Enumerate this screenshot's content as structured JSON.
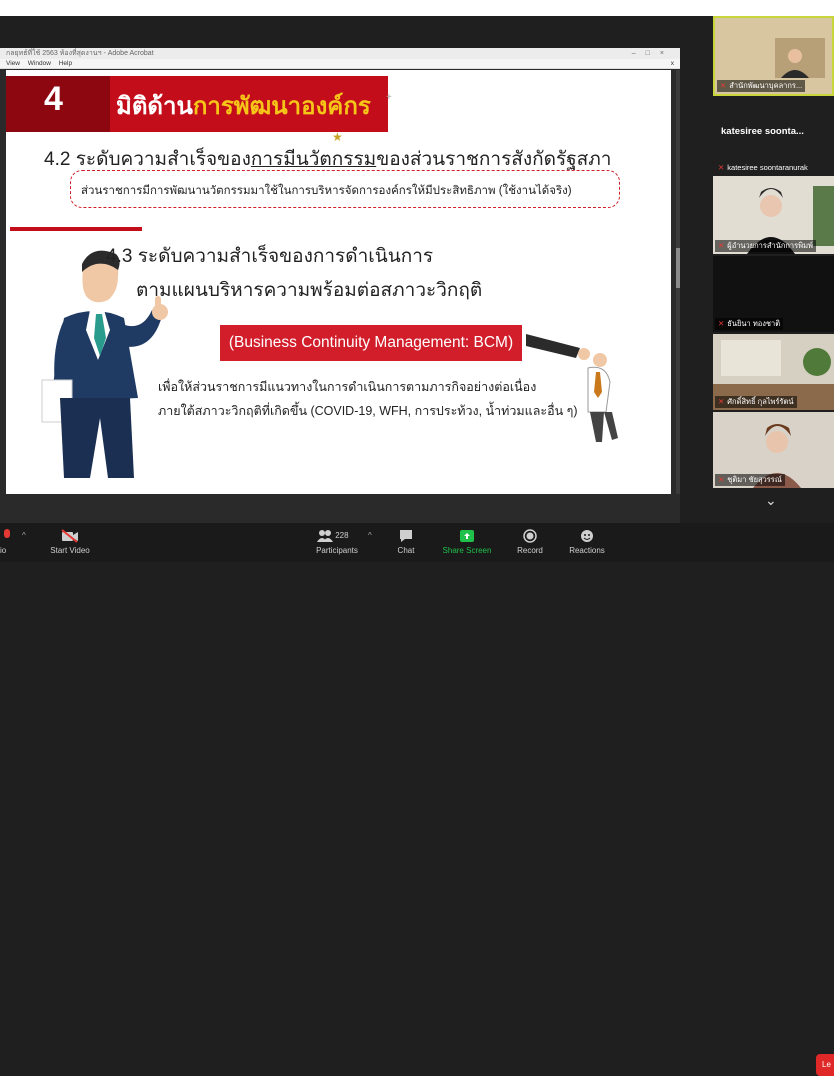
{
  "window": {
    "title": "กลยุทธ์ที่ใช้ 2563 ห้องที่สุดงานฯ - Adobe Acrobat",
    "menu": [
      "View",
      "Window",
      "Help"
    ],
    "close": "x"
  },
  "slide": {
    "header_number": "4",
    "header_title_prefix": "มิติด้าน",
    "header_title_highlight": "การพัฒนาองค์กร",
    "plus": "+",
    "h42_prefix": "4.2  ระดับความสำเร็จของ",
    "h42_underlined": "การมีนวัตกรรม",
    "h42_suffix": "ของส่วนราชการสังกัดรัฐสภา",
    "h42_note": "ส่วนราชการมีการพัฒนานวัตกรรมมาใช้ในการบริหารจัดการองค์กรให้มีประสิทธิภาพ (ใช้งานได้จริง)",
    "h43_line1": "4.3  ระดับความสำเร็จของการดำเนินการ",
    "h43_line2": "ตามแผนบริหารความพร้อมต่อสภาวะวิกฤติ",
    "bcm": "(Business Continuity Management: BCM)",
    "body_line1": "เพื่อให้ส่วนราชการมีแนวทางในการดำเนินการตามภารกิจอย่างต่อเนื่อง",
    "body_line2": "ภายใต้สภาวะวิกฤติที่เกิดขึ้น (COVID-19, WFH, การประท้วง, น้ำท่วมและอื่น ๆ)"
  },
  "participants_panel": {
    "tiles": [
      {
        "name": "สำนักพัฒนาบุคลากร...",
        "speaking": true
      },
      {
        "name": "katesiree soonta...",
        "sub": "katesiree soontaranurak"
      },
      {
        "name": "ผู้อำนวยการสำนักการพิมพ์"
      },
      {
        "name": "ธันยินา ทองชาติ"
      },
      {
        "name": "ศักดิ์สิทธิ์ กุลไพร์รัตน์"
      },
      {
        "name": "ชุติมา ชัยสุวรรณ์"
      }
    ],
    "scroll_down": "⌄"
  },
  "toolbar": {
    "audio_label": "io",
    "start_video": "Start Video",
    "participants": "Participants",
    "participants_count": "228",
    "chat": "Chat",
    "share_screen": "Share Screen",
    "record": "Record",
    "reactions": "Reactions",
    "leave": "Le"
  },
  "colors": {
    "accent_red": "#c40d1b",
    "share_green": "#1fc14a",
    "highlight_yellow": "#f5c518"
  }
}
